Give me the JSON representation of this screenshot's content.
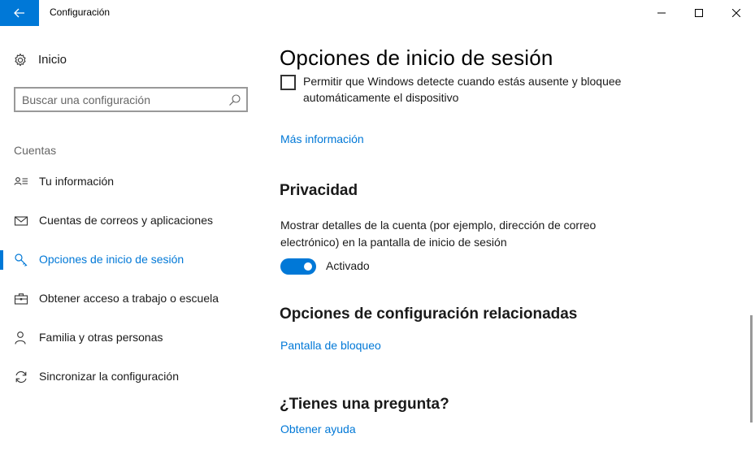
{
  "window": {
    "title": "Configuración",
    "accent": "#0078d7"
  },
  "sidebar": {
    "home_label": "Inicio",
    "search_placeholder": "Buscar una configuración",
    "section_label": "Cuentas",
    "items": [
      {
        "label": "Tu información",
        "icon": "user-info-icon",
        "active": false
      },
      {
        "label": "Cuentas de correos y aplicaciones",
        "icon": "mail-icon",
        "active": false
      },
      {
        "label": "Opciones de inicio de sesión",
        "icon": "key-icon",
        "active": true
      },
      {
        "label": "Obtener acceso a trabajo o escuela",
        "icon": "briefcase-icon",
        "active": false
      },
      {
        "label": "Familia y otras personas",
        "icon": "person-icon",
        "active": false
      },
      {
        "label": "Sincronizar la configuración",
        "icon": "sync-icon",
        "active": false
      }
    ]
  },
  "main": {
    "title": "Opciones de inicio de sesión",
    "checkbox_text": "Permitir que Windows detecte cuando estás ausente y bloquee automáticamente el dispositivo",
    "checkbox_checked": false,
    "more_info_link": "Más información",
    "privacy_heading": "Privacidad",
    "privacy_desc": "Mostrar detalles de la cuenta (por ejemplo, dirección de correo electrónico) en la pantalla de inicio de sesión",
    "toggle_on": true,
    "toggle_label": "Activado",
    "related_heading": "Opciones de configuración relacionadas",
    "lockscreen_link": "Pantalla de bloqueo",
    "question_heading": "¿Tienes una pregunta?",
    "help_link": "Obtener ayuda"
  }
}
